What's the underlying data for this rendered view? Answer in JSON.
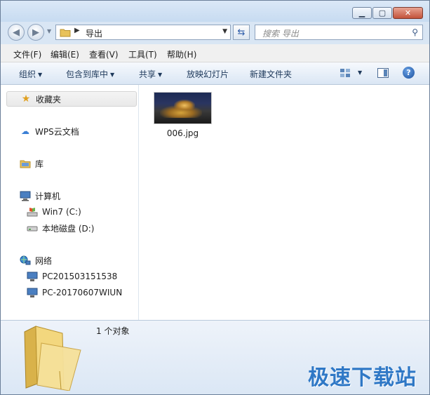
{
  "address": {
    "path": "导出"
  },
  "search": {
    "placeholder": "搜索 导出"
  },
  "menu": [
    "文件(F)",
    "编辑(E)",
    "查看(V)",
    "工具(T)",
    "帮助(H)"
  ],
  "commands": [
    "组织",
    "包含到库中",
    "共享",
    "放映幻灯片",
    "新建文件夹"
  ],
  "nav": {
    "favorites": "收藏夹",
    "wps_cloud": "WPS云文档",
    "libraries": "库",
    "computer": "计算机",
    "drive_c": "Win7 (C:)",
    "drive_d": "本地磁盘 (D:)",
    "network": "网络",
    "pc1": "PC201503151538",
    "pc2": "PC-20170607WIUN"
  },
  "files": [
    {
      "name": "006.jpg"
    }
  ],
  "status": {
    "count": "1 个对象"
  },
  "watermark": "极速下载站",
  "colors": {
    "accent": "#2f78c6",
    "close_button": "#c3523a",
    "selection": "#e9e9e9"
  }
}
